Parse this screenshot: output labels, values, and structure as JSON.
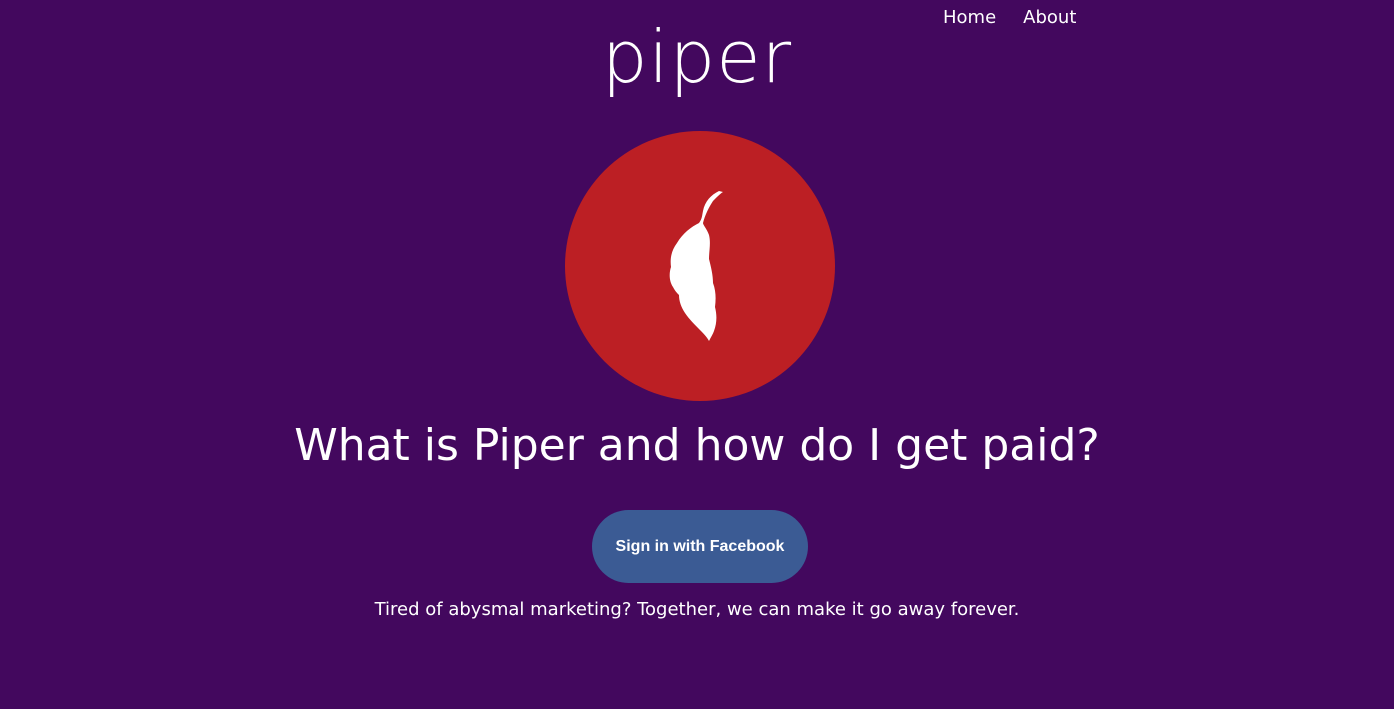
{
  "nav": {
    "home_label": "Home",
    "about_label": "About"
  },
  "brand": {
    "name": "piper",
    "logo_icon": "chili-pepper-icon"
  },
  "main": {
    "headline": "What is Piper and how do I get paid?",
    "signin_label": "Sign in with Facebook",
    "tagline": "Tired of abysmal marketing? Together, we can make it go away forever."
  },
  "colors": {
    "background": "#43085e",
    "logo_circle": "#bc1f24",
    "facebook_button": "#3b5b94",
    "text": "#ffffff"
  }
}
